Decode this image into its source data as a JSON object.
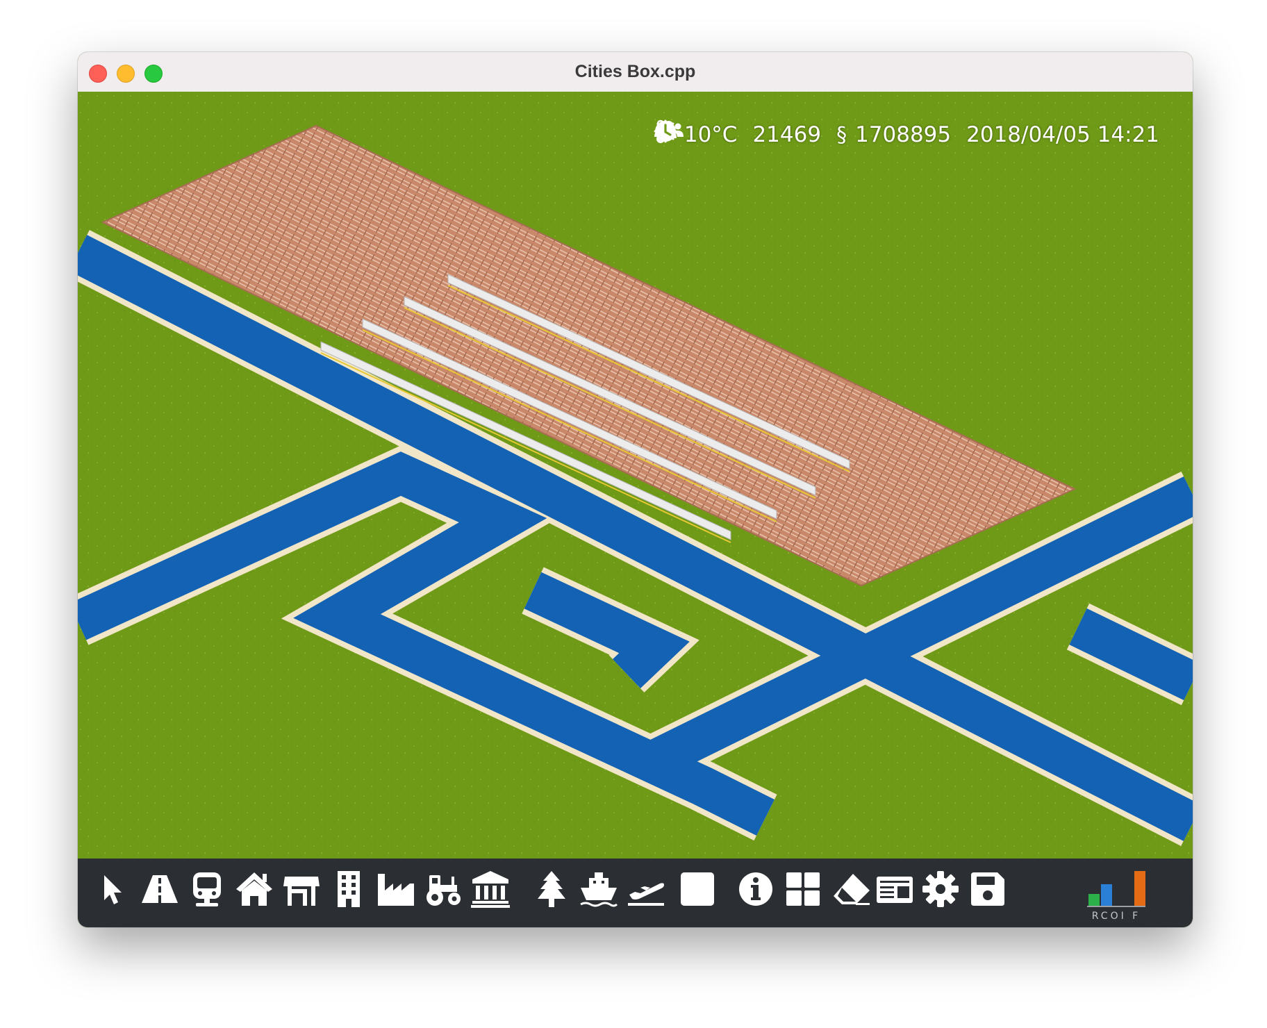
{
  "window": {
    "title": "Cities Box.cpp"
  },
  "hud": {
    "weather_icon": "sun-icon",
    "temperature": "10°C",
    "population": "21469",
    "money_symbol": "§",
    "money": "1708895",
    "datetime": "2018/04/05 14:21"
  },
  "colors": {
    "grass": "#6f9a17",
    "water": "#1462b4",
    "station_ground": "#c9896a",
    "toolbar": "#2b2f33",
    "demand_residential": "#2bb04a",
    "demand_commercial": "#2a7fd6",
    "demand_industrial": "#e56b14"
  },
  "toolbar": {
    "tools": [
      {
        "name": "select-tool",
        "icon": "cursor-icon"
      },
      {
        "name": "road-tool",
        "icon": "road-icon"
      },
      {
        "name": "rail-tool",
        "icon": "train-icon"
      },
      {
        "name": "residential-tool",
        "icon": "house-icon"
      },
      {
        "name": "commercial-tool",
        "icon": "shop-icon"
      },
      {
        "name": "office-tool",
        "icon": "office-building-icon"
      },
      {
        "name": "industrial-tool",
        "icon": "factory-icon"
      },
      {
        "name": "farming-tool",
        "icon": "tractor-icon"
      },
      {
        "name": "services-tool",
        "icon": "government-building-icon"
      },
      {
        "name": "parks-tool",
        "icon": "tree-icon"
      },
      {
        "name": "harbor-tool",
        "icon": "ship-icon"
      },
      {
        "name": "airport-tool",
        "icon": "plane-takeoff-icon"
      },
      {
        "name": "terrain-tool",
        "icon": "square-icon"
      },
      {
        "name": "info-tool",
        "icon": "info-icon"
      },
      {
        "name": "districts-tool",
        "icon": "grid-icon"
      },
      {
        "name": "bulldoze-tool",
        "icon": "eraser-icon"
      },
      {
        "name": "budget-tool",
        "icon": "ledger-icon"
      },
      {
        "name": "settings-tool",
        "icon": "gear-icon"
      },
      {
        "name": "save-tool",
        "icon": "floppy-disk-icon"
      }
    ],
    "demand_label": "RCOI F",
    "demand": {
      "residential": 0.3,
      "commercial": 0.55,
      "industrial": 0.9
    }
  }
}
